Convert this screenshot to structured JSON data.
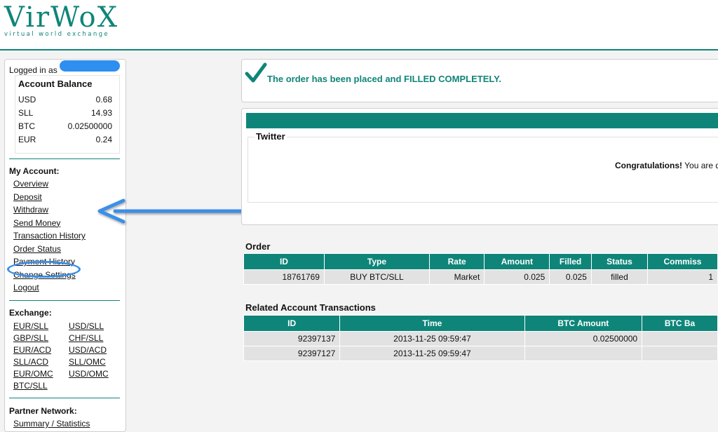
{
  "logo": {
    "name": "VirWoX",
    "tagline": "virtual world exchange"
  },
  "sidebar": {
    "logged_in_label": "Logged in as",
    "balance_title": "Account Balance",
    "balances": [
      {
        "currency": "USD",
        "amount": "0.68"
      },
      {
        "currency": "SLL",
        "amount": "14.93"
      },
      {
        "currency": "BTC",
        "amount": "0.02500000"
      },
      {
        "currency": "EUR",
        "amount": "0.24"
      }
    ],
    "my_account_title": "My Account:",
    "my_account_links": [
      "Overview",
      "Deposit",
      "Withdraw",
      "Send Money",
      "Transaction History",
      "Order Status",
      "Payment History",
      "Change Settings",
      "Logout"
    ],
    "exchange_title": "Exchange:",
    "exchange_links": [
      "EUR/SLL",
      "USD/SLL",
      "GBP/SLL",
      "CHF/SLL",
      "EUR/ACD",
      "USD/ACD",
      "SLL/ACD",
      "SLL/OMC",
      "EUR/OMC",
      "USD/OMC",
      "BTC/SLL"
    ],
    "partner_title": "Partner Network:",
    "partner_links": [
      "Summary / Statistics"
    ]
  },
  "notice": {
    "text": "The order has been placed and FILLED COMPLETELY."
  },
  "twitter": {
    "legend": "Twitter",
    "congrats_bold": "Congratulations!",
    "congrats_rest": " You are q"
  },
  "order": {
    "title": "Order",
    "headers": [
      "ID",
      "Type",
      "Rate",
      "Amount",
      "Filled",
      "Status",
      "Commiss"
    ],
    "row": [
      "18761769",
      "BUY BTC/SLL",
      "Market",
      "0.025",
      "0.025",
      "filled",
      "1"
    ]
  },
  "transactions": {
    "title": "Related Account Transactions",
    "headers": [
      "ID",
      "Time",
      "BTC Amount",
      "BTC Ba"
    ],
    "rows": [
      [
        "92397137",
        "2013-11-25 09:59:47",
        "0.02500000",
        ""
      ],
      [
        "92397127",
        "2013-11-25 09:59:47",
        "",
        ""
      ]
    ]
  },
  "colors": {
    "brand": "#0f8579",
    "annotation": "#3a8fe8"
  },
  "icons": {
    "check": "check-icon",
    "arrow": "arrow-left-annotation"
  }
}
